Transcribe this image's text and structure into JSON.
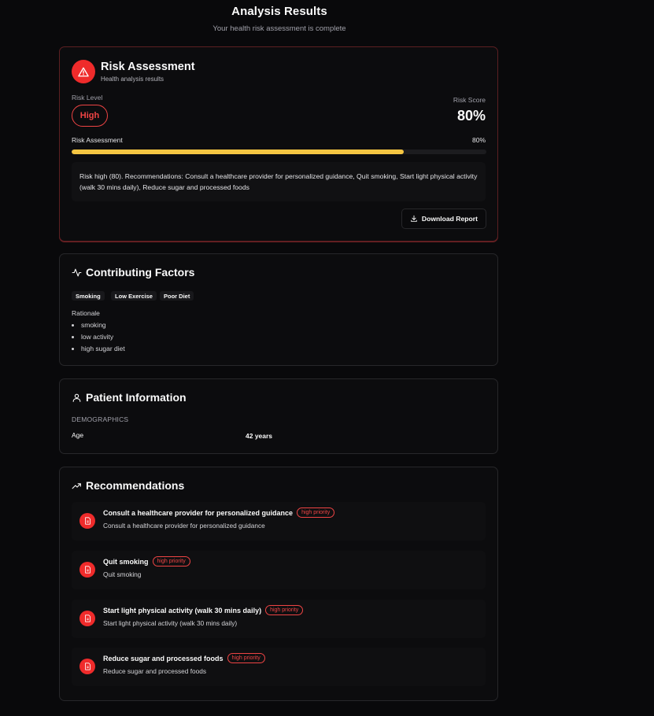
{
  "header": {
    "title": "Analysis Results",
    "subtitle": "Your health risk assessment is complete"
  },
  "risk": {
    "title": "Risk Assessment",
    "subtitle": "Health analysis results",
    "level_label": "Risk Level",
    "level": "High",
    "score_label": "Risk Score",
    "score": "80%",
    "assessment_label": "Risk Assessment",
    "assessment_percent": "80%",
    "progress_fraction": 0.8,
    "summary": "Risk high (80). Recommendations: Consult a healthcare provider for personalized guidance, Quit smoking, Start light physical activity (walk 30 mins daily), Reduce sugar and processed foods",
    "download_label": "Download Report",
    "icons": {
      "badge": "warning-triangle-icon",
      "download": "download-icon"
    }
  },
  "factors": {
    "title": "Contributing Factors",
    "icon": "activity-icon",
    "tags": [
      "Smoking",
      "Low Exercise",
      "Poor Diet"
    ],
    "rationale_label": "Rationale",
    "rationale": [
      "smoking",
      "low activity",
      "high sugar diet"
    ]
  },
  "patient": {
    "title": "Patient Information",
    "icon": "user-icon",
    "demographics_label": "DEMOGRAPHICS",
    "age_label": "Age",
    "age_value": "42 years"
  },
  "recommendations": {
    "title": "Recommendations",
    "icon": "trending-up-icon",
    "item_icon": "document-icon",
    "items": [
      {
        "title": "Consult a healthcare provider for personalized guidance",
        "priority": "high priority",
        "description": "Consult a healthcare provider for personalized guidance"
      },
      {
        "title": "Quit smoking",
        "priority": "high priority",
        "description": "Quit smoking"
      },
      {
        "title": "Start light physical activity (walk 30 mins daily)",
        "priority": "high priority",
        "description": "Start light physical activity (walk 30 mins daily)"
      },
      {
        "title": "Reduce sugar and processed foods",
        "priority": "high priority",
        "description": "Reduce sugar and processed foods"
      }
    ]
  },
  "colors": {
    "background": "#09090b",
    "card": "#0c0c0e",
    "danger": "#ef4444",
    "progress": "#f5c542"
  }
}
